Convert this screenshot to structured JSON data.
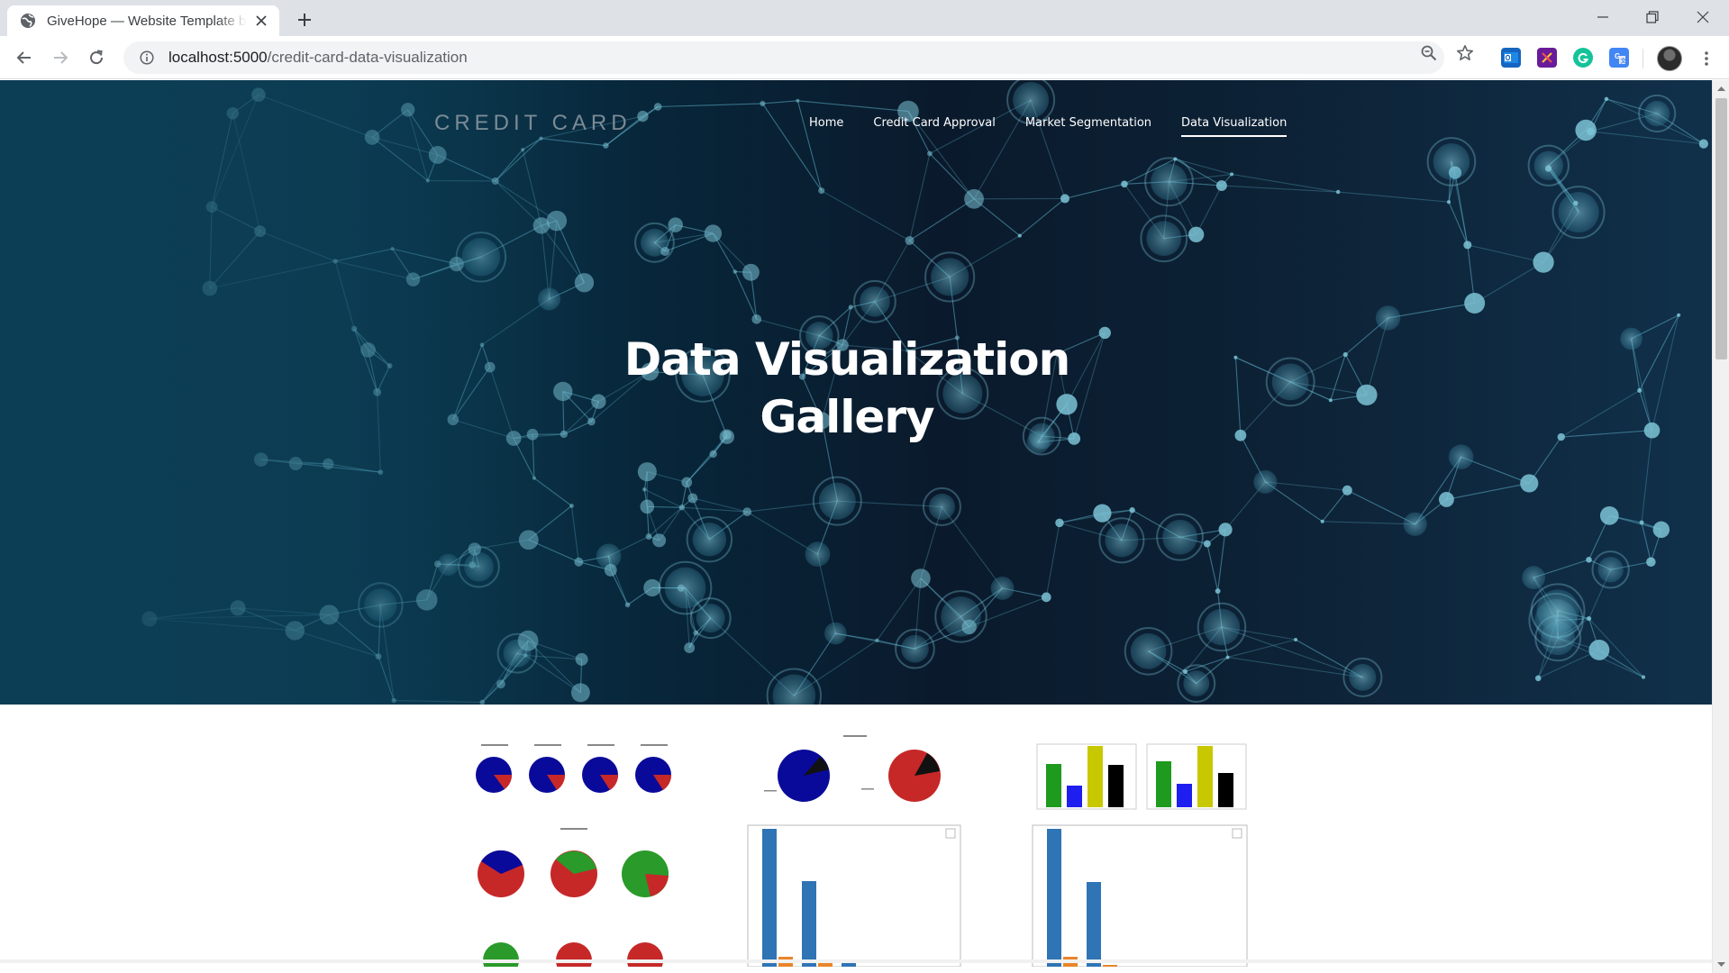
{
  "browser": {
    "tab_title": "GiveHope — Website Template by",
    "url_host": "localhost:5000",
    "url_path": "/credit-card-data-visualization",
    "extensions": [
      "outlook-icon",
      "reader-icon",
      "grammarly-icon",
      "translate-icon"
    ]
  },
  "site": {
    "brand": "CREDIT CARD",
    "nav": [
      {
        "label": "Home",
        "active": false
      },
      {
        "label": "Credit Card Approval",
        "active": false
      },
      {
        "label": "Market Segmentation",
        "active": false
      },
      {
        "label": "Data Visualization",
        "active": true
      }
    ],
    "hero_title_line1": "Data Visualization",
    "hero_title_line2": "Gallery"
  },
  "gallery": {
    "items": [
      {
        "kind": "four-pies-blue-red"
      },
      {
        "kind": "two-pies-blue-red"
      },
      {
        "kind": "two-bar-charts-green-blue-yellow-black"
      },
      {
        "kind": "pie-grid-red-blue-green"
      },
      {
        "kind": "bar-chart-blue-orange"
      },
      {
        "kind": "bar-chart-blue-orange"
      }
    ]
  },
  "colors": {
    "hero_bg": "#0a1a2c",
    "network_line": "#4fa0b6",
    "pie_blue": "#0a0a9a",
    "pie_red": "#c62828",
    "pie_green": "#2a9a2a",
    "bar_blue": "#2f74b5",
    "bar_orange": "#e8852b"
  }
}
